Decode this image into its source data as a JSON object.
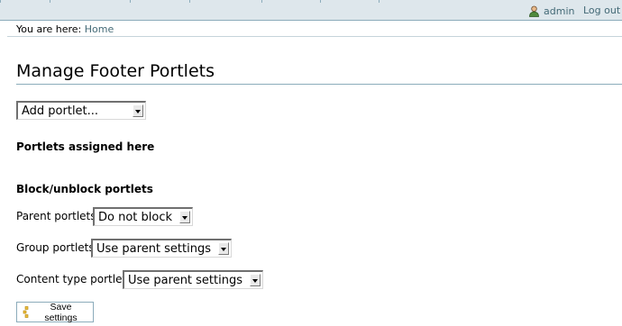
{
  "topbar": {
    "user_name": "admin",
    "logout_label": "Log out",
    "icons": {
      "user": "user-icon"
    }
  },
  "breadcrumb": {
    "prefix": "You are here:",
    "home_label": "Home"
  },
  "main": {
    "title": "Manage Footer Portlets",
    "add_portlet": {
      "selected": "Add portlet..."
    },
    "assigned_heading": "Portlets assigned here",
    "block_heading": "Block/unblock portlets",
    "parent": {
      "label": "Parent portlets:",
      "selected": "Do not block"
    },
    "group": {
      "label": "Group portlets:",
      "selected": "Use parent settings"
    },
    "content_type": {
      "label": "Content type portlets:",
      "selected": "Use parent settings"
    },
    "save_label": "Save settings"
  },
  "colors": {
    "topbar_bg": "#dee7ec",
    "border": "#8cacbb",
    "link": "#436976"
  }
}
